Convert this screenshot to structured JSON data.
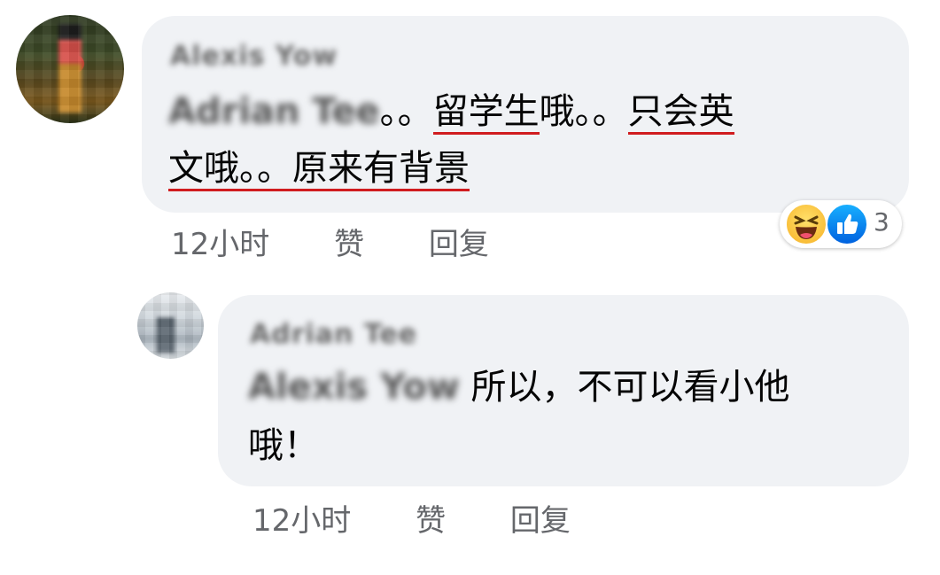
{
  "comment": {
    "author": "Alexis Yow",
    "mention": "Adrian Tee",
    "text_line1_a": "。。",
    "text_line1_u1": "留学生",
    "text_line1_b": "哦。。",
    "text_line1_u2": "只会英",
    "text_line2_u": "文哦。。原来有背景",
    "time": "12小时",
    "like_label": "赞",
    "reply_label": "回复",
    "reaction_count": "3",
    "reaction_icons": [
      "haha-icon",
      "like-icon"
    ]
  },
  "reply": {
    "author": "Adrian Tee",
    "mention": "Alexis Yow",
    "text_line1": " 所以，不可以看小他",
    "text_line2": "哦！",
    "time": "12小时",
    "like_label": "赞",
    "reply_label": "回复"
  },
  "colors": {
    "bubble": "#f0f2f5",
    "meta": "#65676b",
    "underline": "#d01c1f",
    "like_blue": "#1877f2",
    "haha_yellow": "#f7b125"
  }
}
